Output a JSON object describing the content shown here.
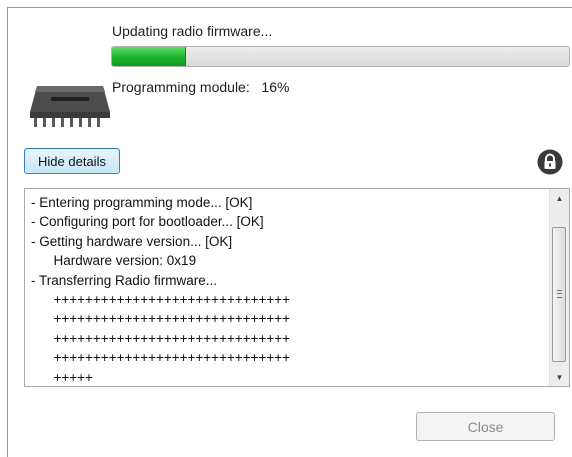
{
  "status": {
    "title": "Updating radio firmware...",
    "module_label": "Programming module:",
    "percent_text": "16%",
    "progress_fraction": 0.16
  },
  "icons": {
    "chip": "chip-icon",
    "lock": "lock-icon"
  },
  "details": {
    "toggle_label": "Hide details"
  },
  "log": {
    "lines": [
      "- Entering programming mode... [OK]",
      "- Configuring port for bootloader... [OK]",
      "- Getting hardware version... [OK]",
      "      Hardware version: 0x19",
      "- Transferring Radio firmware...",
      "      ++++++++++++++++++++++++++++++",
      "      ++++++++++++++++++++++++++++++",
      "      ++++++++++++++++++++++++++++++",
      "      ++++++++++++++++++++++++++++++",
      "      +++++"
    ]
  },
  "footer": {
    "close_label": "Close"
  },
  "colors": {
    "progress": "#1db32a",
    "accent_button": "#3c7fb1"
  }
}
